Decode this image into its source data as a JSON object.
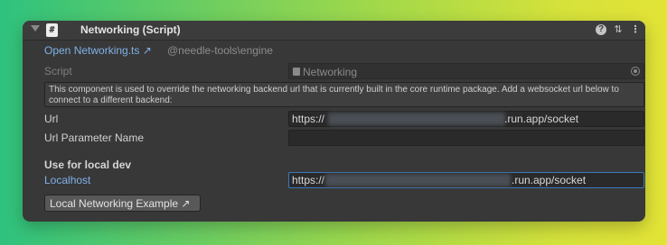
{
  "component": {
    "title": "Networking (Script)",
    "file_icon": "#"
  },
  "header_icons": {
    "fold": "foldout-arrow-down",
    "help": "?",
    "presets": "⇅",
    "more": "⋮"
  },
  "links": {
    "open_file": "Open Networking.ts ↗",
    "package": "@needle-tools\\engine"
  },
  "script": {
    "label": "Script",
    "value": "Networking"
  },
  "help_text": "This component is used to override the networking backend url that is currently built in the core runtime package. Add a websocket url below to connect to a different backend:",
  "fields": {
    "url": {
      "label": "Url",
      "value_start": "https://",
      "value_end": ".run.app/socket"
    },
    "url_parameter_name": {
      "label": "Url Parameter Name",
      "value": ""
    }
  },
  "section": {
    "title": "Use for local dev"
  },
  "localhost": {
    "label": "Localhost",
    "value_start": "https://",
    "value_end": ".run.app/socket"
  },
  "example_button": {
    "label": "Local Networking Example ↗"
  },
  "colors": {
    "panel_bg": "#383838",
    "link_blue": "#7fb1e8",
    "focus_border": "#3a79bb"
  }
}
